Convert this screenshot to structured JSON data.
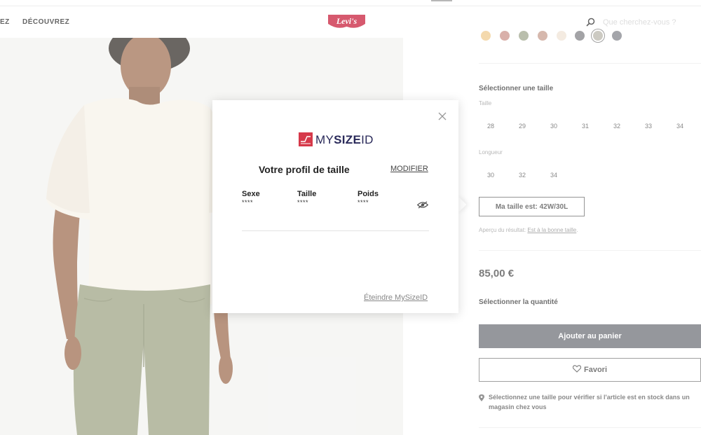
{
  "header": {
    "nav_partial": "EZ",
    "nav_discover": "DÉCOUVREZ",
    "logo_text": "Levi's",
    "search_placeholder": "Que cherchez-vous ?"
  },
  "swatch_colors": [
    "#f0c98a",
    "#c98f86",
    "#9ba388",
    "#c49a8a",
    "#efe3d4",
    "#7b7c80",
    "#b6b3a8",
    "#7d7f86"
  ],
  "size_section": {
    "title": "Sélectionner une taille",
    "waist_label": "Taille",
    "waist_sizes": [
      "28",
      "29",
      "30",
      "31",
      "32",
      "33",
      "34"
    ],
    "length_label": "Longueur",
    "length_sizes": [
      "30",
      "32",
      "34"
    ],
    "my_size_button": "Ma taille est: 42W/30L",
    "result_prefix": "Aperçu du résultat:",
    "result_link": "Est à la bonne taille",
    "result_suffix": "."
  },
  "price": "85,00 €",
  "quantity_title": "Sélectionner la quantité",
  "add_to_cart": "Ajouter au panier",
  "favorite": "Favori",
  "stock_text": "Sélectionnez une taille pour vérifier si l'article est en stock dans un magasin chez vous",
  "modal": {
    "brand_prefix": "MY",
    "brand_bold": "SIZE",
    "brand_suffix": "ID",
    "title": "Votre profil de taille",
    "modify": "MODIFIER",
    "fields": [
      {
        "label": "Sexe",
        "value": "****"
      },
      {
        "label": "Taille",
        "value": "****"
      },
      {
        "label": "Poids",
        "value": "****"
      }
    ],
    "turn_off": "Éteindre MySizeID"
  },
  "colors": {
    "levis_red": "#c41230",
    "mysize_red": "#d6394a",
    "cart_button": "#686a72"
  }
}
